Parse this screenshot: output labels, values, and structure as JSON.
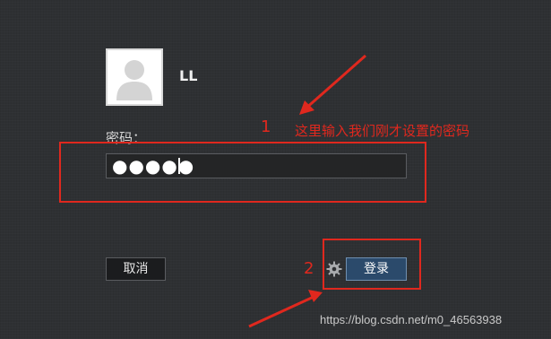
{
  "user": {
    "name": "LL"
  },
  "password": {
    "label": "密码：",
    "value": "●●●●●"
  },
  "buttons": {
    "cancel_label": "取消",
    "login_label": "登录"
  },
  "annotations": {
    "step1_number": "1",
    "step1_text": "这里输入我们刚才设置的密码",
    "step2_number": "2",
    "color": "#e0281e"
  },
  "watermark": "https://blog.csdn.net/m0_46563938",
  "icons": {
    "avatar": "user-avatar-icon",
    "gear": "gear-icon"
  }
}
